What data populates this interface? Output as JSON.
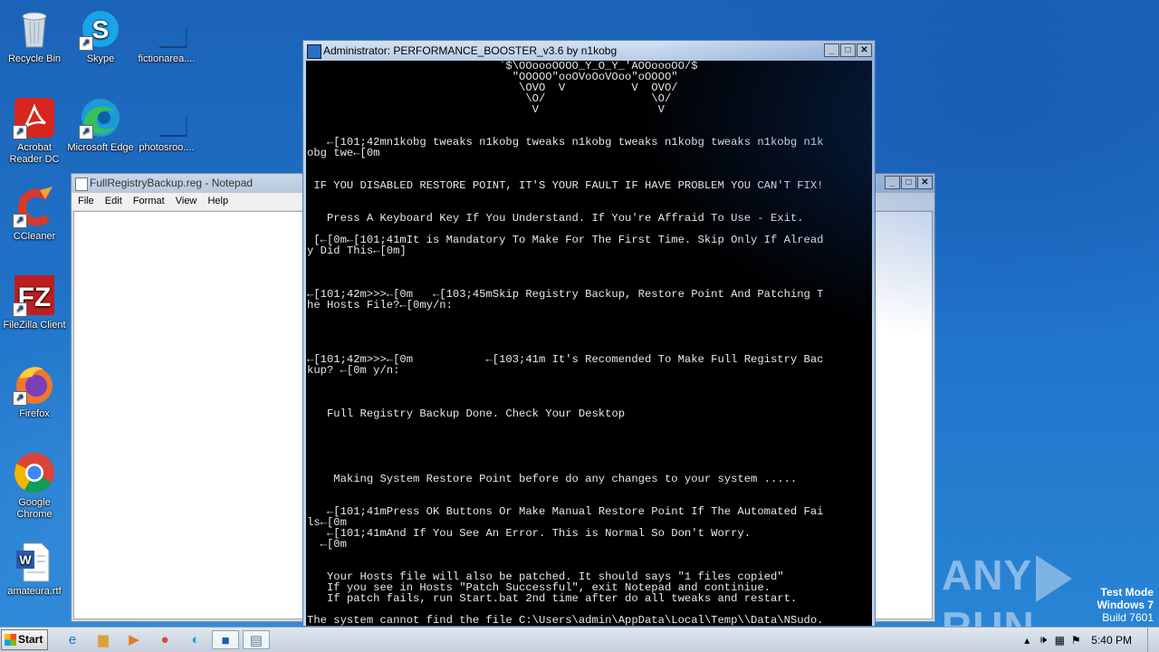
{
  "desktop_icons": [
    {
      "id": "recycle-bin",
      "label": "Recycle Bin",
      "icon": "recycle-bin-icon",
      "color": "#c7d3de"
    },
    {
      "id": "skype",
      "label": "Skype",
      "icon": "skype-icon",
      "color": "#1aa5e8"
    },
    {
      "id": "fictionarea",
      "label": "fictionarea....",
      "icon": "blank-file-icon",
      "color": "#1f5fb8"
    },
    {
      "id": "acrobat",
      "label": "Acrobat Reader DC",
      "icon": "acrobat-icon",
      "color": "#d7261e"
    },
    {
      "id": "edge",
      "label": "Microsoft Edge",
      "icon": "edge-icon",
      "color": "#1c9bd8"
    },
    {
      "id": "photosroo",
      "label": "photosroo....",
      "icon": "blank-file-icon",
      "color": "#1f5fb8"
    },
    {
      "id": "ccleaner",
      "label": "CCleaner",
      "icon": "ccleaner-icon",
      "color": "#d63a2a"
    },
    {
      "id": "filezilla",
      "label": "FileZilla Client",
      "icon": "filezilla-icon",
      "color": "#bf1e1e"
    },
    {
      "id": "firefox",
      "label": "Firefox",
      "icon": "firefox-icon",
      "color": "#f0772d"
    },
    {
      "id": "chrome",
      "label": "Google Chrome",
      "icon": "chrome-icon",
      "color": "#34a853"
    },
    {
      "id": "amateura",
      "label": "amateura.rtf",
      "icon": "word-doc-icon",
      "color": "#2a5aa8"
    }
  ],
  "notepad": {
    "title": "FullRegistryBackup.reg - Notepad",
    "menu": [
      "File",
      "Edit",
      "Format",
      "View",
      "Help"
    ]
  },
  "console": {
    "title": "Administrator:  PERFORMANCE_BOOSTER_v3.6 by n1kobg",
    "text": "                             `$\\OOoooOOOO_Y_O_Y_'AOOoooOO/$\n                               \"OOOOO\"ooOVoOoVOoo\"oOOOO\"\n                                \\OVO  V          V  OVO/\n                                 \\O/                \\O/\n                                  V                  V\n\n\n   ←[101;42mn1kobg tweaks n1kobg tweaks n1kobg tweaks n1kobg tweaks n1kobg n1k\nobg twe←[0m\n\n\n IF YOU DISABLED RESTORE POINT, IT'S YOUR FAULT IF HAVE PROBLEM YOU CAN'T FIX!\n\n\n   Press A Keyboard Key If You Understand. If You're Affraid To Use - Exit.\n\n [←[0m←[101;41mIt is Mandatory To Make For The First Time. Skip Only If Alread\ny Did This←[0m]\n\n\n\n←[101;42m>>>←[0m   ←[103;45mSkip Registry Backup, Restore Point And Patching T\nhe Hosts File?←[0my/n:\n\n\n\n\n←[101;42m>>>←[0m           ←[103;41m It's Recomended To Make Full Registry Bac\nkup? ←[0m y/n:\n\n\n\n   Full Registry Backup Done. Check Your Desktop\n\n\n\n\n\n    Making System Restore Point before do any changes to your system .....\n\n\n   ←[101;41mPress OK Buttons Or Make Manual Restore Point If The Automated Fai\nls←[0m\n   ←[101;41mAnd If You See An Error. This is Normal So Don't Worry.\n  ←[0m\n\n\n   Your Hosts file will also be patched. It should says \"1 files copied\"\n   If you see in Hosts \"Patch Successful\", exit Notepad and continiue.\n   If patch fails, run Start.bat 2nd time after do all tweaks and restart.\n\nThe system cannot find the file C:\\Users\\admin\\AppData\\Local\\Temp\\\\Data\\NSudo.\nexe.\nThe system cannot find the file C:\\Users\\admin\\AppData\\Local\\Temp\\\\Data\\NSudo."
  },
  "window_buttons": {
    "minimize": "_",
    "maximize": "□",
    "close": "✕"
  },
  "watermark": {
    "left": "ANY",
    "right": "RUN"
  },
  "test_mode": {
    "line1": "Test Mode",
    "line2": "Windows 7",
    "line3": "Build 7601"
  },
  "taskbar": {
    "start_label": "Start",
    "apps": [
      "ie-icon",
      "explorer-icon",
      "media-player-icon",
      "chrome-icon",
      "edge-icon",
      "console-icon",
      "notepad-icon"
    ],
    "clock": "5:40 PM"
  }
}
